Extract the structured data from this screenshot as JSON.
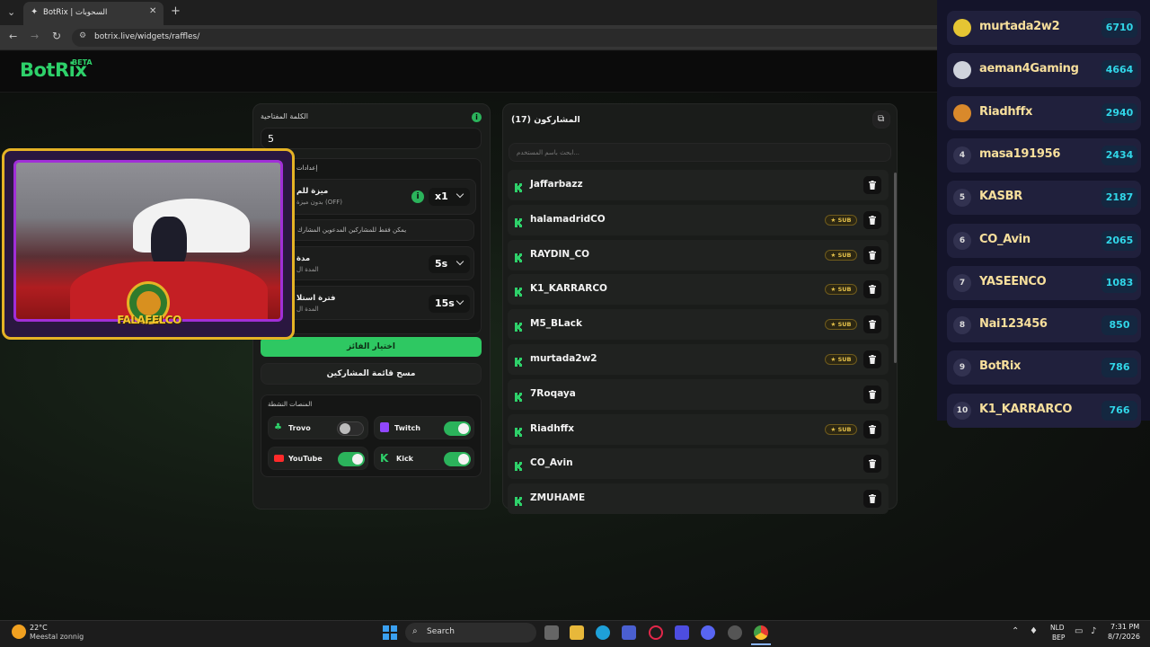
{
  "browser": {
    "tab_title": "BotRix | السحوبات",
    "url": "botrix.live/widgets/raffles/"
  },
  "logo": {
    "text": "BotRix",
    "beta": "BETA"
  },
  "settings": {
    "keyword_label": "الكلمة المفتاحية",
    "keyword_value": "5",
    "section_label": "إعدادات",
    "sub_title": "ميزة للم",
    "sub_desc": "بدون ميزة (OFF)",
    "sub_multiplier": "x1",
    "note": "يمكن فقط للمشاركين المدعوين المشارك",
    "duration_title": "مدة",
    "duration_desc": "المدة ال",
    "duration_value": "5s",
    "interval_title": "فترة استلا",
    "interval_desc": "المدة ال",
    "interval_value": "15s",
    "pick_winner": "اختيار الفائز",
    "clear_list": "مسح قائمة المشاركين",
    "platforms_label": "المنصات النشطة",
    "platforms": [
      {
        "name": "Trovo",
        "on": false
      },
      {
        "name": "Twitch",
        "on": true
      },
      {
        "name": "YouTube",
        "on": true
      },
      {
        "name": "Kick",
        "on": true
      }
    ]
  },
  "participants": {
    "title": "المشاركون (17)",
    "search_placeholder": "ابحث باسم المستخدم...",
    "sub_badge": "SUB",
    "items": [
      {
        "name": "Jaffarbazz",
        "sub": false
      },
      {
        "name": "halamadridCO",
        "sub": true
      },
      {
        "name": "RAYDIN_CO",
        "sub": true
      },
      {
        "name": "K1_KARRARCO",
        "sub": true
      },
      {
        "name": "M5_BLack",
        "sub": true
      },
      {
        "name": "murtada2w2",
        "sub": true
      },
      {
        "name": "7Roqaya",
        "sub": false
      },
      {
        "name": "Riadhffx",
        "sub": true
      },
      {
        "name": "CO_Avin",
        "sub": false
      },
      {
        "name": "ZMUHAME",
        "sub": false
      }
    ]
  },
  "leaderboard": [
    {
      "rank": "",
      "name": "murtada2w2",
      "score": "6710"
    },
    {
      "rank": "",
      "name": "aeman4Gaming",
      "score": "4664"
    },
    {
      "rank": "",
      "name": "Riadhffx",
      "score": "2940"
    },
    {
      "rank": "4",
      "name": "masa191956",
      "score": "2434"
    },
    {
      "rank": "5",
      "name": "KASBR",
      "score": "2187"
    },
    {
      "rank": "6",
      "name": "CO_Avin",
      "score": "2065"
    },
    {
      "rank": "7",
      "name": "YASEENCO",
      "score": "1083"
    },
    {
      "rank": "8",
      "name": "Nai123456",
      "score": "850"
    },
    {
      "rank": "9",
      "name": "BotRix",
      "score": "786"
    },
    {
      "rank": "10",
      "name": "K1_KARRARCO",
      "score": "766"
    }
  ],
  "webcam": {
    "overlay_text": "FALAFELCO"
  },
  "taskbar": {
    "temp": "22°C",
    "weather": "Meestal zonnig",
    "search": "Search",
    "lang1": "NLD",
    "lang2": "BEP",
    "time": "7:31 PM",
    "date": "8/7/2026"
  },
  "colors": {
    "accent": "#2ed16a",
    "sub_badge": "#e5c14a",
    "score": "#31d6e8"
  }
}
